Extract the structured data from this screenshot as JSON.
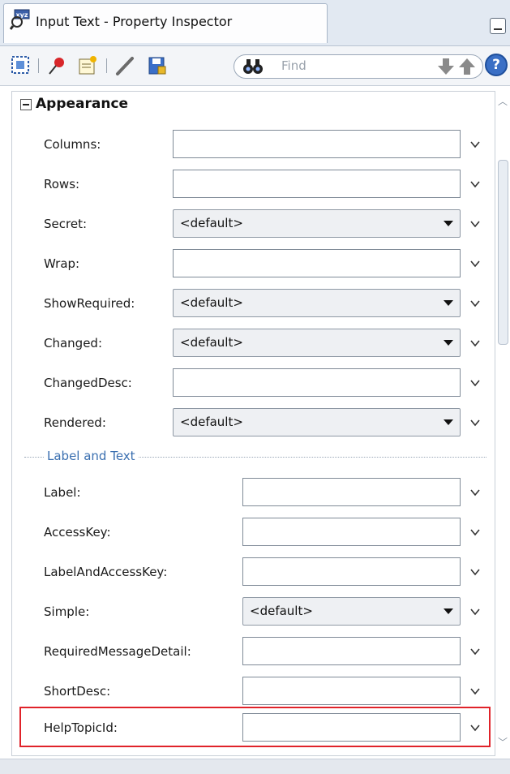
{
  "window": {
    "title": "Input Text - Property Inspector",
    "app_icon": "property-inspector-icon"
  },
  "toolbar": {
    "icons": [
      "select-component-icon",
      "pin-icon",
      "edit-properties-icon",
      "pencil-icon",
      "save-icon"
    ],
    "find_placeholder": "Find",
    "find_icon": "binoculars-icon",
    "nav_icons": [
      "arrow-down-icon",
      "arrow-up-icon"
    ],
    "help_label": "?"
  },
  "section": {
    "title": "Appearance",
    "expanded": true
  },
  "appearance_rows": [
    {
      "label": "Columns:",
      "type": "text",
      "value": ""
    },
    {
      "label": "Rows:",
      "type": "text",
      "value": ""
    },
    {
      "label": "Secret:",
      "type": "select",
      "value": "<default>"
    },
    {
      "label": "Wrap:",
      "type": "text",
      "value": ""
    },
    {
      "label": "ShowRequired:",
      "type": "select",
      "value": "<default>"
    },
    {
      "label": "Changed:",
      "type": "select",
      "value": "<default>"
    },
    {
      "label": "ChangedDesc:",
      "type": "text",
      "value": ""
    },
    {
      "label": "Rendered:",
      "type": "select",
      "value": "<default>"
    }
  ],
  "group": {
    "label": "Label and Text"
  },
  "label_rows": [
    {
      "label": "Label:",
      "type": "text",
      "value": ""
    },
    {
      "label": "AccessKey:",
      "type": "text",
      "value": ""
    },
    {
      "label": "LabelAndAccessKey:",
      "type": "text",
      "value": ""
    },
    {
      "label": "Simple:",
      "type": "select",
      "value": "<default>"
    },
    {
      "label": "RequiredMessageDetail:",
      "type": "text",
      "value": ""
    },
    {
      "label": "ShortDesc:",
      "type": "text",
      "value": ""
    },
    {
      "label": "HelpTopicId:",
      "type": "text",
      "value": "",
      "highlighted": true
    }
  ],
  "colors": {
    "highlight": "#e0232a",
    "group_label": "#3a6fb0"
  }
}
